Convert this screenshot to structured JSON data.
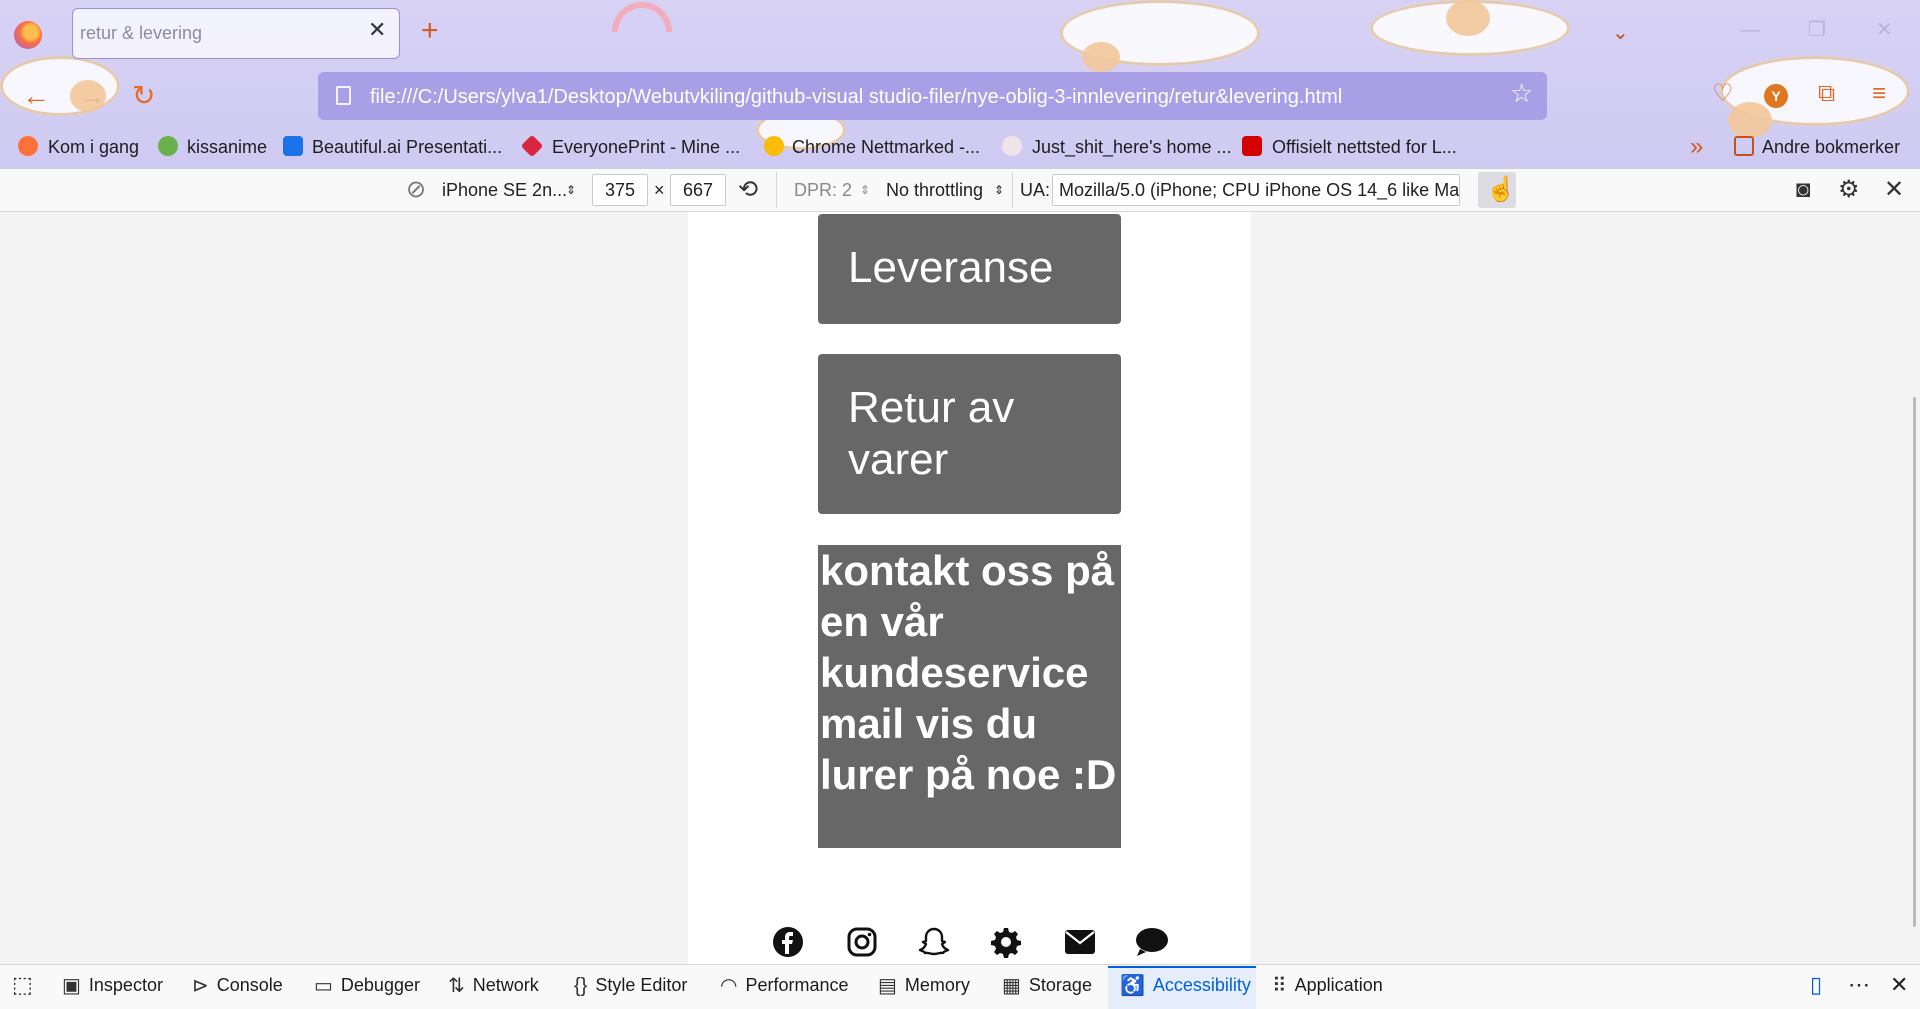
{
  "browser": {
    "tab_title": "retur & levering",
    "url": "file:///C:/Users/ylva1/Desktop/Webutvkiling/github-visual studio-filer/nye-oblig-3-innlevering/retur&levering.html",
    "avatar_letter": "Y",
    "bookmarks": [
      {
        "label": "Kom i gang",
        "color": "#ff7139"
      },
      {
        "label": "kissanime",
        "color": "#6ab04c"
      },
      {
        "label": "Beautiful.ai Presentati...",
        "color": "#1a73e8"
      },
      {
        "label": "EveryonePrint - Mine ...",
        "color": "#d7263d"
      },
      {
        "label": "Chrome Nettmarked -...",
        "color": "#fbbc05"
      },
      {
        "label": "Just_shit_here's home ...",
        "color": "#e91e63"
      },
      {
        "label": "Offisielt nettsted for L...",
        "color": "#d50000"
      }
    ],
    "other_bookmarks": "Andre bokmerker"
  },
  "rdm": {
    "device": "iPhone SE 2n...",
    "width": "375",
    "times": "×",
    "height": "667",
    "dpr": "DPR: 2",
    "throttling": "No throttling",
    "ua_label": "UA:",
    "ua_value": "Mozilla/5.0 (iPhone; CPU iPhone OS 14_6 like Mac"
  },
  "page": {
    "cards": [
      "Leveranse",
      "Retur av varer"
    ],
    "contact_text": "kontakt oss på en vår kundeservice mail vis du lurer på noe :D",
    "social_icons": [
      "facebook-icon",
      "instagram-icon",
      "snapchat-icon",
      "settings-icon",
      "mail-icon",
      "chat-icon"
    ]
  },
  "devtools": {
    "tabs": [
      "Inspector",
      "Console",
      "Debugger",
      "Network",
      "Style Editor",
      "Performance",
      "Memory",
      "Storage",
      "Accessibility",
      "Application"
    ],
    "active_tab": "Accessibility",
    "accent": "#0061e0"
  }
}
